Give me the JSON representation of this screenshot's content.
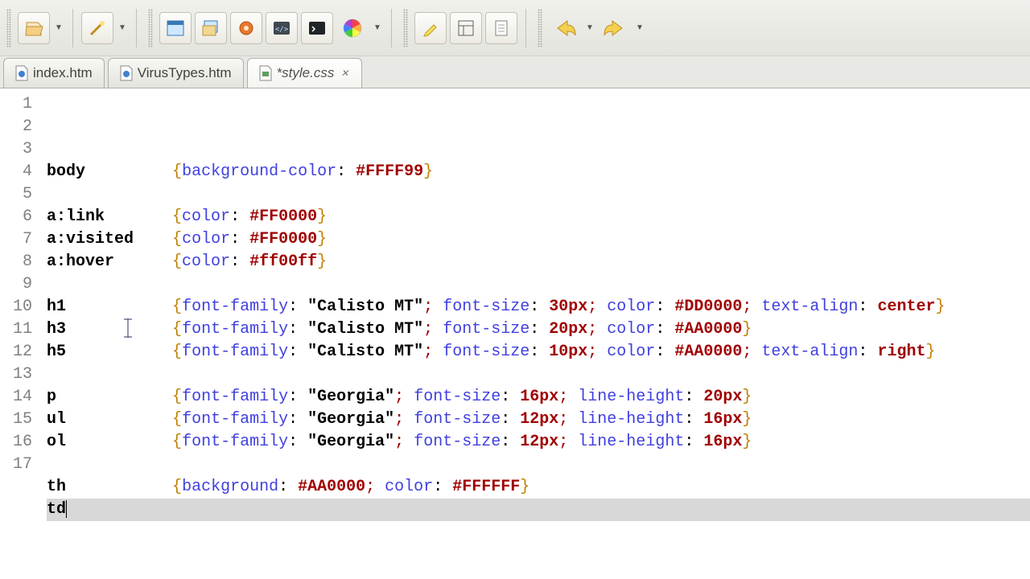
{
  "tabs": [
    {
      "label": "index.htm",
      "active": false
    },
    {
      "label": "VirusTypes.htm",
      "active": false
    },
    {
      "label": "*style.css",
      "active": true
    }
  ],
  "code": {
    "total_lines": 17,
    "current_line": 16,
    "lines": [
      {
        "n": 1,
        "sel": "body",
        "pad": "     ",
        "props": [
          [
            "background-color",
            "#FFFF99",
            "col"
          ]
        ]
      },
      {
        "n": 2,
        "sel": "",
        "pad": "",
        "props": []
      },
      {
        "n": 3,
        "sel": "a:link",
        "pad": "   ",
        "props": [
          [
            "color",
            "#FF0000",
            "col"
          ]
        ]
      },
      {
        "n": 4,
        "sel": "a:visited",
        "pad": "",
        "props": [
          [
            "color",
            "#FF0000",
            "col"
          ]
        ]
      },
      {
        "n": 5,
        "sel": "a:hover",
        "pad": "  ",
        "props": [
          [
            "color",
            "#ff00ff",
            "col"
          ]
        ]
      },
      {
        "n": 6,
        "sel": "",
        "pad": "",
        "props": []
      },
      {
        "n": 7,
        "sel": "h1",
        "pad": "       ",
        "props": [
          [
            "font-family",
            "\"Calisto MT\"",
            "str"
          ],
          [
            "font-size",
            "30px",
            "num"
          ],
          [
            "color",
            "#DD0000",
            "col"
          ],
          [
            "text-align",
            "center",
            "val"
          ]
        ]
      },
      {
        "n": 8,
        "sel": "h3",
        "pad": "       ",
        "props": [
          [
            "font-family",
            "\"Calisto MT\"",
            "str"
          ],
          [
            "font-size",
            "20px",
            "num"
          ],
          [
            "color",
            "#AA0000",
            "col"
          ]
        ]
      },
      {
        "n": 9,
        "sel": "h5",
        "pad": "       ",
        "props": [
          [
            "font-family",
            "\"Calisto MT\"",
            "str"
          ],
          [
            "font-size",
            "10px",
            "num"
          ],
          [
            "color",
            "#AA0000",
            "col"
          ],
          [
            "text-align",
            "right",
            "val"
          ]
        ]
      },
      {
        "n": 10,
        "sel": "",
        "pad": "",
        "props": []
      },
      {
        "n": 11,
        "sel": "p",
        "pad": "        ",
        "props": [
          [
            "font-family",
            "\"Georgia\"",
            "str"
          ],
          [
            "font-size",
            "16px",
            "num"
          ],
          [
            "line-height",
            "20px",
            "num"
          ]
        ]
      },
      {
        "n": 12,
        "sel": "ul",
        "pad": "       ",
        "props": [
          [
            "font-family",
            "\"Georgia\"",
            "str"
          ],
          [
            "font-size",
            "12px",
            "num"
          ],
          [
            "line-height",
            "16px",
            "num"
          ]
        ]
      },
      {
        "n": 13,
        "sel": "ol",
        "pad": "       ",
        "props": [
          [
            "font-family",
            "\"Georgia\"",
            "str"
          ],
          [
            "font-size",
            "12px",
            "num"
          ],
          [
            "line-height",
            "16px",
            "num"
          ]
        ]
      },
      {
        "n": 14,
        "sel": "",
        "pad": "",
        "props": []
      },
      {
        "n": 15,
        "sel": "th",
        "pad": "       ",
        "props": [
          [
            "background",
            "#AA0000",
            "col"
          ],
          [
            "color",
            "#FFFFFF",
            "col"
          ]
        ]
      },
      {
        "n": 16,
        "sel": "td",
        "pad": "",
        "props": [],
        "cursor": true
      },
      {
        "n": 17,
        "sel": "",
        "pad": "",
        "props": []
      }
    ]
  },
  "icons": {
    "new": "new",
    "wand": "wand",
    "win1": "window",
    "win2": "window2",
    "gear": "gear",
    "code": "code",
    "term": "terminal",
    "color": "color-picker",
    "highlight": "highlighter",
    "layout": "layout",
    "page": "page",
    "back": "back",
    "forward": "forward"
  }
}
